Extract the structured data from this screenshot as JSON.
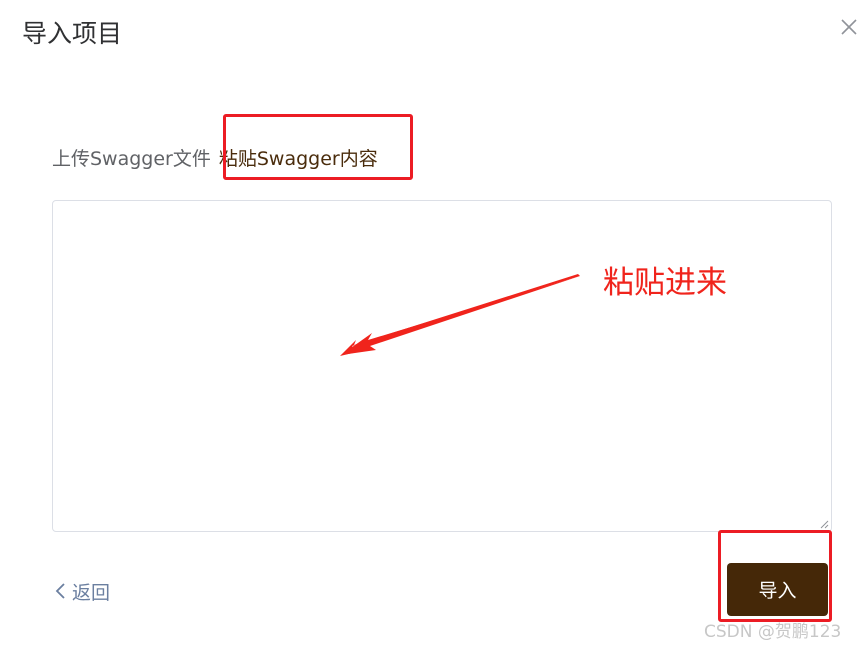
{
  "dialog": {
    "title": "导入项目",
    "close_icon": "close-icon"
  },
  "tabs": [
    {
      "label": "上传Swagger文件",
      "active": false
    },
    {
      "label": "粘贴Swagger内容",
      "active": true
    }
  ],
  "editor": {
    "value": "",
    "placeholder": ""
  },
  "annotation": {
    "text": "粘贴进来",
    "color": "#f0241c"
  },
  "footer": {
    "back_label": "返回",
    "back_icon": "chevron-left-icon",
    "import_label": "导入"
  },
  "colors": {
    "primary_button": "#452808",
    "active_tab_text": "#4a2c0c",
    "highlight_box": "#ec1c24",
    "link": "#6b7fa0"
  },
  "watermark": "CSDN @贺鹏123"
}
